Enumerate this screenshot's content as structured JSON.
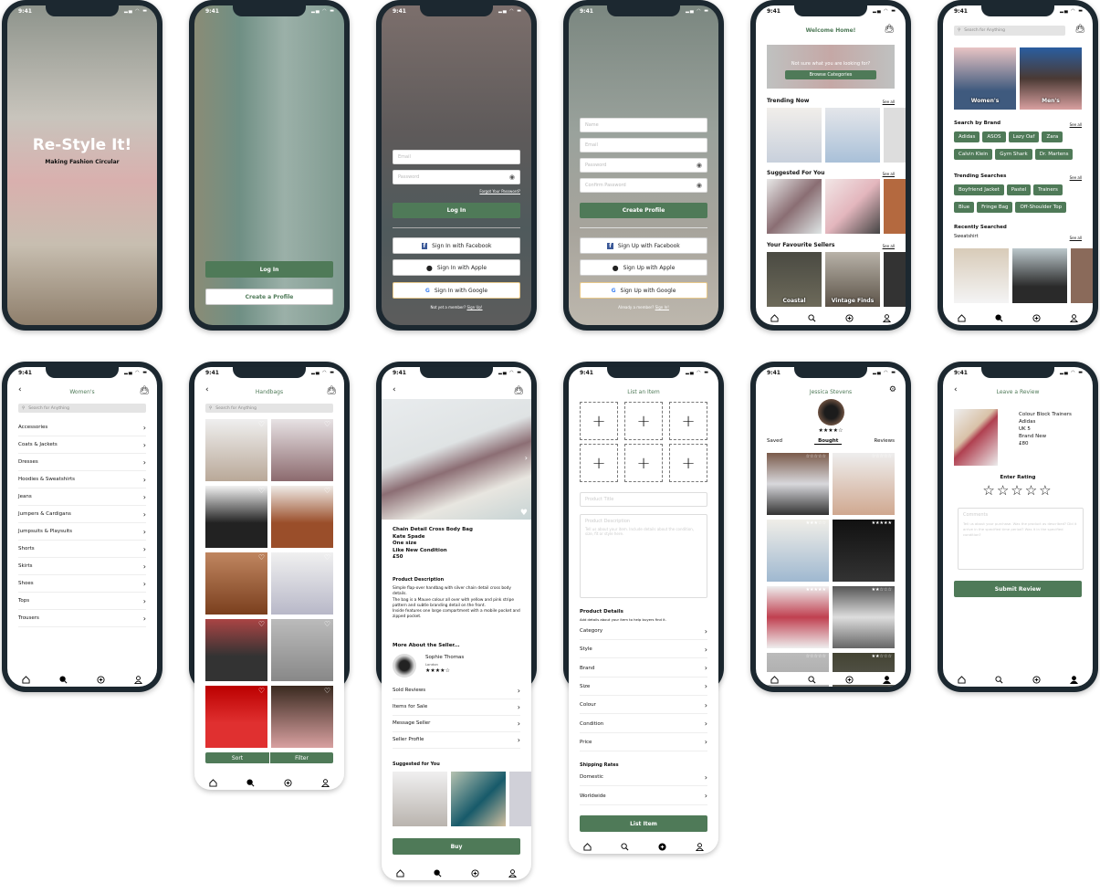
{
  "status": {
    "time": "9:41"
  },
  "colors": {
    "accent": "#4f7a58",
    "frame": "#1c2830"
  },
  "splash": {
    "title": "Re-Style It!",
    "subtitle": "Making Fashion Circular"
  },
  "welcome": {
    "login": "Log In",
    "create": "Create a Profile"
  },
  "login": {
    "email": "Email",
    "password": "Password",
    "forgot": "Forgot Your Password?",
    "login": "Log In",
    "facebook": "Sign In with Facebook",
    "apple": "Sign In with Apple",
    "google": "Sign In with Google",
    "footer": "Not yet a member?",
    "footer_link": "Sign Up!"
  },
  "signup": {
    "name": "Name",
    "email": "Email",
    "password": "Password",
    "confirm": "Confirm Password",
    "create": "Create Profile",
    "facebook": "Sign Up with Facebook",
    "apple": "Sign Up with Apple",
    "google": "Sign Up with Google",
    "footer": "Already a member?",
    "footer_link": "Sign In!"
  },
  "home": {
    "title": "Welcome Home!",
    "banner_text": "Not sure what you are looking for?",
    "banner_button": "Browse Categories",
    "trending": "Trending Now",
    "suggested": "Suggested For You",
    "sellers_title": "Your Favourite Sellers",
    "see_all": "See all",
    "sellers": [
      "Coastal",
      "Vintage Finds"
    ]
  },
  "search": {
    "placeholder": "Search for Anything",
    "women": "Women's",
    "men": "Men's",
    "brand_title": "Search by Brand",
    "brands": [
      "Adidas",
      "ASOS",
      "Lazy Oaf",
      "Zara",
      "Calvin Klein",
      "Gym Shark",
      "Dr. Martens"
    ],
    "trending_title": "Trending Searches",
    "trending": [
      "Boyfriend Jacket",
      "Pastel",
      "Trainers",
      "Blue",
      "Fringe Bag",
      "Off-Shoulder Top"
    ],
    "recent_title": "Recently Searched",
    "recent": "Sweatshirt",
    "see_all": "See all"
  },
  "women": {
    "title": "Women's",
    "placeholder": "Search for Anything",
    "categories": [
      "Accessories",
      "Coats & Jackets",
      "Dresses",
      "Hoodies & Sweatshirts",
      "Jeans",
      "Jumpers & Cardigans",
      "Jumpsuits & Playsuits",
      "Shorts",
      "Skirts",
      "Shoes",
      "Tops",
      "Trousers"
    ]
  },
  "handbags": {
    "title": "Handbags",
    "placeholder": "Search for Anything",
    "sort": "Sort",
    "filter": "Filter"
  },
  "product": {
    "name": "Chain Detail Cross Body Bag",
    "brand": "Kate Spade",
    "size": "One size",
    "condition": "Like New Condition",
    "price": "£50",
    "desc_title": "Product Description",
    "desc": "Simple flap-over handbag with silver chain detail cross body details.\nThe bag is a Mauve colour all over with yellow and pink stripe pattern and subtle branding detail on the front.\nInside features one large compartment with a mobile pocket and zipped pocket.",
    "seller_title": "More About the Seller...",
    "seller_name": "Sophie Thomas",
    "seller_location": "London",
    "seller_rating": 4,
    "links": [
      "Sold Reviews",
      "Items for Sale",
      "Message Seller",
      "Seller Profile"
    ],
    "suggested_title": "Suggested for You",
    "buy": "Buy"
  },
  "list": {
    "title": "List an Item",
    "product_title": "Product Title",
    "product_desc": "Product Description",
    "desc_hint": "Tell us about your item. Include details about the condition, size, fit or style here.",
    "details_title": "Product Details",
    "details_hint": "Add details about your item to help buyers find it.",
    "details": [
      "Category",
      "Style",
      "Brand",
      "Size",
      "Colour",
      "Condition",
      "Price"
    ],
    "shipping_title": "Shipping Rates",
    "shipping": [
      "Domestic",
      "Worldwide"
    ],
    "button": "List Item"
  },
  "profile": {
    "name": "Jessica Stevens",
    "rating": 4,
    "tabs": [
      "Saved",
      "Bought",
      "Reviews"
    ],
    "active_tab": "Bought",
    "item_ratings": [
      0,
      0,
      3,
      5,
      5,
      2,
      0,
      2
    ]
  },
  "review": {
    "title": "Leave a Review",
    "item": [
      "Colour Block Trainers",
      "Adidas",
      "UK 5",
      "Brand New",
      "£80"
    ],
    "rating_label": "Enter Rating",
    "rating": 0,
    "comments": "Comments",
    "comments_hint": "Tell us about your purchase. Was the product as described? Did it arrive in the specified time period? Was it in the specified condition?",
    "submit": "Submit Review"
  }
}
